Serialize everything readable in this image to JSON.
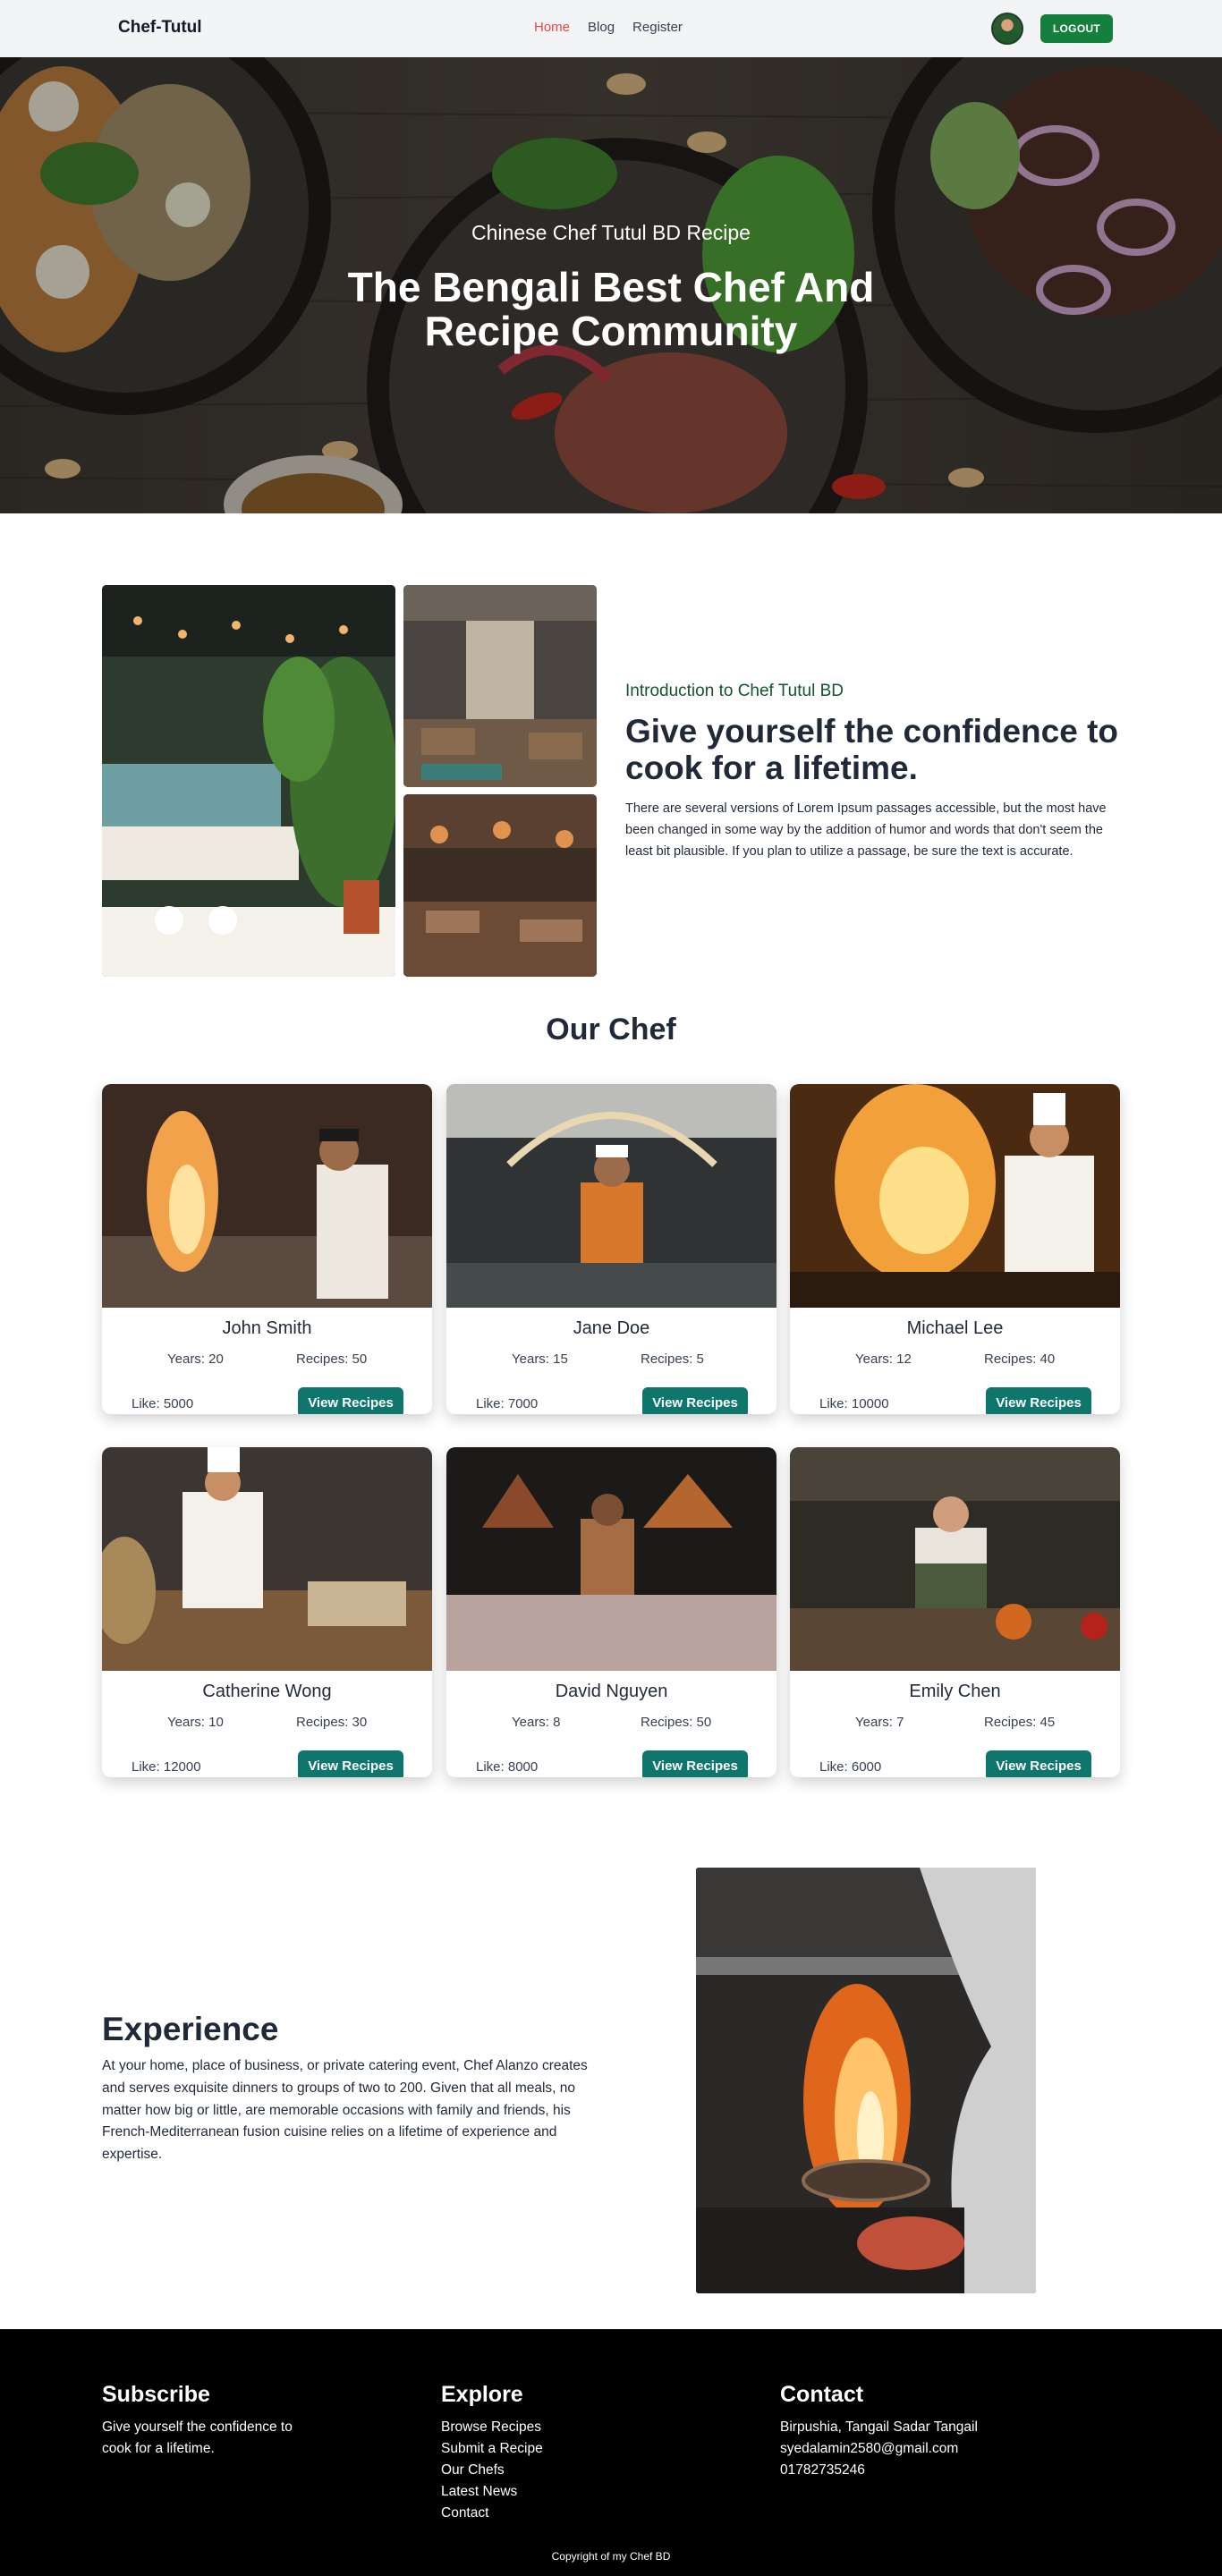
{
  "nav": {
    "brand": "Chef-Tutul",
    "links": [
      "Home",
      "Blog",
      "Register"
    ],
    "logout_label": "LOGOUT"
  },
  "hero": {
    "subtitle": "Chinese Chef Tutul BD Recipe",
    "title": "The Bengali Best Chef And Recipe Community"
  },
  "intro": {
    "kicker": "Introduction to Chef Tutul BD",
    "title": "Give yourself the confidence to cook for a lifetime.",
    "text": "There are several versions of Lorem Ipsum passages accessible, but the most have been changed in some way by the addition of humor and words that don't seem the least bit plausible. If you plan to utilize a passage, be sure the text is accurate."
  },
  "chefs": {
    "title": "Our Chef",
    "button_label": "View Recipes",
    "items": [
      {
        "name": "John Smith",
        "years": "Years: 20",
        "recipes": "Recipes: 50",
        "likes": "Like: 5000"
      },
      {
        "name": "Jane Doe",
        "years": "Years: 15",
        "recipes": "Recipes: 5",
        "likes": "Like: 7000"
      },
      {
        "name": "Michael Lee",
        "years": "Years: 12",
        "recipes": "Recipes: 40",
        "likes": "Like: 10000"
      },
      {
        "name": "Catherine Wong",
        "years": "Years: 10",
        "recipes": "Recipes: 30",
        "likes": "Like: 12000"
      },
      {
        "name": "David Nguyen",
        "years": "Years: 8",
        "recipes": "Recipes: 50",
        "likes": "Like: 8000"
      },
      {
        "name": "Emily Chen",
        "years": "Years: 7",
        "recipes": "Recipes: 45",
        "likes": "Like: 6000"
      }
    ]
  },
  "experience": {
    "title": "Experience",
    "text": "At your home, place of business, or private catering event, Chef Alanzo creates and serves exquisite dinners to groups of two to 200. Given that all meals, no matter how big or little, are memorable occasions with family and friends, his French-Mediterranean fusion cuisine relies on a lifetime of experience and expertise."
  },
  "footer": {
    "subscribe": {
      "title": "Subscribe",
      "text": "Give yourself the confidence to cook for a lifetime."
    },
    "explore": {
      "title": "Explore",
      "links": [
        "Browse Recipes",
        "Submit a Recipe",
        "Our Chefs",
        "Latest News",
        "Contact"
      ]
    },
    "contact": {
      "title": "Contact",
      "lines": [
        "Birpushia, Tangail Sadar Tangail",
        "syedalamin2580@gmail.com",
        "01782735246"
      ]
    },
    "copyright": "Copyright of my Chef BD"
  },
  "colors": {
    "accent_red": "#ef4444",
    "logout_green": "#15803d",
    "intro_kicker_green": "#14532d",
    "button_teal": "#0f766e",
    "footer_bg": "#000000"
  }
}
